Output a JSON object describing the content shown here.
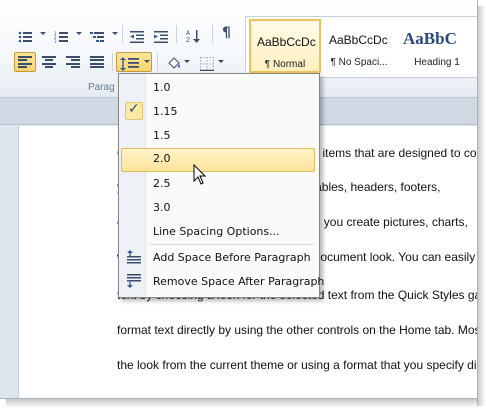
{
  "ribbon": {
    "group_label": "Parag",
    "styles": [
      {
        "preview": "AaBbCcDc",
        "name": "¶ Normal",
        "active": true
      },
      {
        "preview": "AaBbCcDc",
        "name": "¶ No Spaci...",
        "active": false
      },
      {
        "preview": "AaBbC",
        "name": "Heading 1",
        "active": false
      }
    ],
    "pilcrow": "¶",
    "sort_label": "A Z"
  },
  "line_spacing_menu": {
    "options": [
      {
        "label": "1.0",
        "checked": false,
        "hover": false
      },
      {
        "label": "1.15",
        "checked": true,
        "hover": false
      },
      {
        "label": "1.5",
        "checked": false,
        "hover": false
      },
      {
        "label": "2.0",
        "checked": false,
        "hover": true
      },
      {
        "label": "2.5",
        "checked": false,
        "hover": false
      },
      {
        "label": "3.0",
        "checked": false,
        "hover": false
      }
    ],
    "more_options": "Line Spacing Options...",
    "add_space_before": "Add Space Before Paragraph",
    "remove_space_after": "Remove Space After Paragraph",
    "check_glyph": "✓"
  },
  "document": {
    "lines": [
      "On the Insert tab, the galleries include items that are designed to coordinate",
      "you can use these galleries to insert tables, headers, footers,",
      "other document building blocks. When you create pictures, charts,",
      "will also coordinate with your current document look. You can easily change the",
      "text by choosing a look for the selected text from the Quick Styles gallery",
      "format text directly by using the other controls on the Home tab. Most controls offer",
      "the look from the current theme or using a format that you specify directly."
    ]
  }
}
